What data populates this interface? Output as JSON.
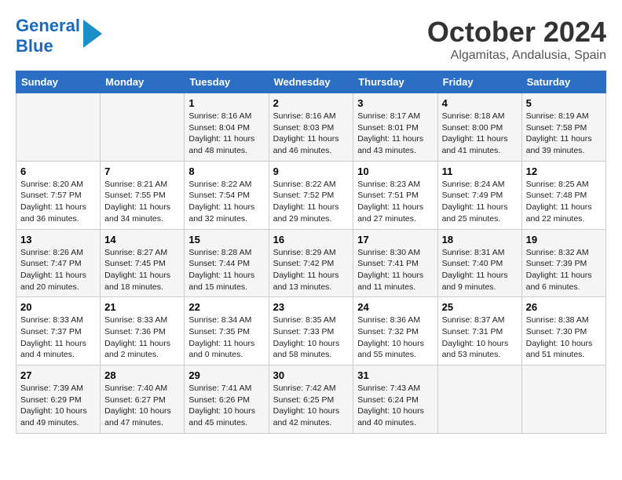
{
  "logo": {
    "line1": "General",
    "line2": "Blue"
  },
  "title": {
    "month_year": "October 2024",
    "location": "Algamitas, Andalusia, Spain"
  },
  "headers": [
    "Sunday",
    "Monday",
    "Tuesday",
    "Wednesday",
    "Thursday",
    "Friday",
    "Saturday"
  ],
  "weeks": [
    [
      {
        "day": "",
        "sunrise": "",
        "sunset": "",
        "daylight": ""
      },
      {
        "day": "",
        "sunrise": "",
        "sunset": "",
        "daylight": ""
      },
      {
        "day": "1",
        "sunrise": "Sunrise: 8:16 AM",
        "sunset": "Sunset: 8:04 PM",
        "daylight": "Daylight: 11 hours and 48 minutes."
      },
      {
        "day": "2",
        "sunrise": "Sunrise: 8:16 AM",
        "sunset": "Sunset: 8:03 PM",
        "daylight": "Daylight: 11 hours and 46 minutes."
      },
      {
        "day": "3",
        "sunrise": "Sunrise: 8:17 AM",
        "sunset": "Sunset: 8:01 PM",
        "daylight": "Daylight: 11 hours and 43 minutes."
      },
      {
        "day": "4",
        "sunrise": "Sunrise: 8:18 AM",
        "sunset": "Sunset: 8:00 PM",
        "daylight": "Daylight: 11 hours and 41 minutes."
      },
      {
        "day": "5",
        "sunrise": "Sunrise: 8:19 AM",
        "sunset": "Sunset: 7:58 PM",
        "daylight": "Daylight: 11 hours and 39 minutes."
      }
    ],
    [
      {
        "day": "6",
        "sunrise": "Sunrise: 8:20 AM",
        "sunset": "Sunset: 7:57 PM",
        "daylight": "Daylight: 11 hours and 36 minutes."
      },
      {
        "day": "7",
        "sunrise": "Sunrise: 8:21 AM",
        "sunset": "Sunset: 7:55 PM",
        "daylight": "Daylight: 11 hours and 34 minutes."
      },
      {
        "day": "8",
        "sunrise": "Sunrise: 8:22 AM",
        "sunset": "Sunset: 7:54 PM",
        "daylight": "Daylight: 11 hours and 32 minutes."
      },
      {
        "day": "9",
        "sunrise": "Sunrise: 8:22 AM",
        "sunset": "Sunset: 7:52 PM",
        "daylight": "Daylight: 11 hours and 29 minutes."
      },
      {
        "day": "10",
        "sunrise": "Sunrise: 8:23 AM",
        "sunset": "Sunset: 7:51 PM",
        "daylight": "Daylight: 11 hours and 27 minutes."
      },
      {
        "day": "11",
        "sunrise": "Sunrise: 8:24 AM",
        "sunset": "Sunset: 7:49 PM",
        "daylight": "Daylight: 11 hours and 25 minutes."
      },
      {
        "day": "12",
        "sunrise": "Sunrise: 8:25 AM",
        "sunset": "Sunset: 7:48 PM",
        "daylight": "Daylight: 11 hours and 22 minutes."
      }
    ],
    [
      {
        "day": "13",
        "sunrise": "Sunrise: 8:26 AM",
        "sunset": "Sunset: 7:47 PM",
        "daylight": "Daylight: 11 hours and 20 minutes."
      },
      {
        "day": "14",
        "sunrise": "Sunrise: 8:27 AM",
        "sunset": "Sunset: 7:45 PM",
        "daylight": "Daylight: 11 hours and 18 minutes."
      },
      {
        "day": "15",
        "sunrise": "Sunrise: 8:28 AM",
        "sunset": "Sunset: 7:44 PM",
        "daylight": "Daylight: 11 hours and 15 minutes."
      },
      {
        "day": "16",
        "sunrise": "Sunrise: 8:29 AM",
        "sunset": "Sunset: 7:42 PM",
        "daylight": "Daylight: 11 hours and 13 minutes."
      },
      {
        "day": "17",
        "sunrise": "Sunrise: 8:30 AM",
        "sunset": "Sunset: 7:41 PM",
        "daylight": "Daylight: 11 hours and 11 minutes."
      },
      {
        "day": "18",
        "sunrise": "Sunrise: 8:31 AM",
        "sunset": "Sunset: 7:40 PM",
        "daylight": "Daylight: 11 hours and 9 minutes."
      },
      {
        "day": "19",
        "sunrise": "Sunrise: 8:32 AM",
        "sunset": "Sunset: 7:39 PM",
        "daylight": "Daylight: 11 hours and 6 minutes."
      }
    ],
    [
      {
        "day": "20",
        "sunrise": "Sunrise: 8:33 AM",
        "sunset": "Sunset: 7:37 PM",
        "daylight": "Daylight: 11 hours and 4 minutes."
      },
      {
        "day": "21",
        "sunrise": "Sunrise: 8:33 AM",
        "sunset": "Sunset: 7:36 PM",
        "daylight": "Daylight: 11 hours and 2 minutes."
      },
      {
        "day": "22",
        "sunrise": "Sunrise: 8:34 AM",
        "sunset": "Sunset: 7:35 PM",
        "daylight": "Daylight: 11 hours and 0 minutes."
      },
      {
        "day": "23",
        "sunrise": "Sunrise: 8:35 AM",
        "sunset": "Sunset: 7:33 PM",
        "daylight": "Daylight: 10 hours and 58 minutes."
      },
      {
        "day": "24",
        "sunrise": "Sunrise: 8:36 AM",
        "sunset": "Sunset: 7:32 PM",
        "daylight": "Daylight: 10 hours and 55 minutes."
      },
      {
        "day": "25",
        "sunrise": "Sunrise: 8:37 AM",
        "sunset": "Sunset: 7:31 PM",
        "daylight": "Daylight: 10 hours and 53 minutes."
      },
      {
        "day": "26",
        "sunrise": "Sunrise: 8:38 AM",
        "sunset": "Sunset: 7:30 PM",
        "daylight": "Daylight: 10 hours and 51 minutes."
      }
    ],
    [
      {
        "day": "27",
        "sunrise": "Sunrise: 7:39 AM",
        "sunset": "Sunset: 6:29 PM",
        "daylight": "Daylight: 10 hours and 49 minutes."
      },
      {
        "day": "28",
        "sunrise": "Sunrise: 7:40 AM",
        "sunset": "Sunset: 6:27 PM",
        "daylight": "Daylight: 10 hours and 47 minutes."
      },
      {
        "day": "29",
        "sunrise": "Sunrise: 7:41 AM",
        "sunset": "Sunset: 6:26 PM",
        "daylight": "Daylight: 10 hours and 45 minutes."
      },
      {
        "day": "30",
        "sunrise": "Sunrise: 7:42 AM",
        "sunset": "Sunset: 6:25 PM",
        "daylight": "Daylight: 10 hours and 42 minutes."
      },
      {
        "day": "31",
        "sunrise": "Sunrise: 7:43 AM",
        "sunset": "Sunset: 6:24 PM",
        "daylight": "Daylight: 10 hours and 40 minutes."
      },
      {
        "day": "",
        "sunrise": "",
        "sunset": "",
        "daylight": ""
      },
      {
        "day": "",
        "sunrise": "",
        "sunset": "",
        "daylight": ""
      }
    ]
  ]
}
